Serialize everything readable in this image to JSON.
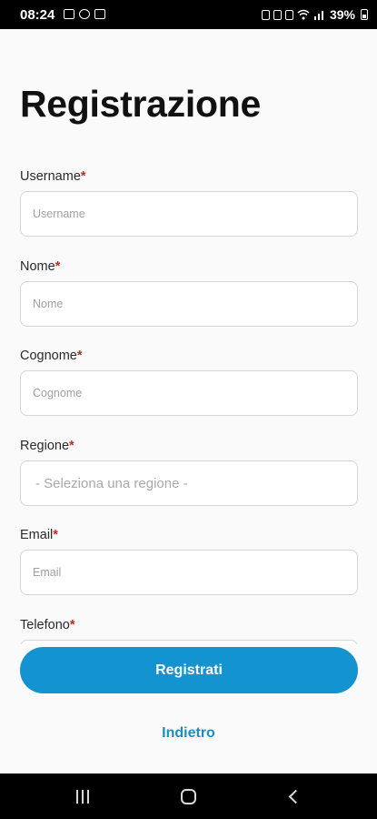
{
  "status_bar": {
    "time": "08:24",
    "battery_text": "39%",
    "left_icons": [
      "gallery-icon",
      "whatsapp-icon",
      "notification-icon"
    ],
    "right_icons": [
      "sim-icon",
      "alarm-icon",
      "mute-icon",
      "wifi-icon",
      "signal-icon",
      "battery-icon"
    ]
  },
  "page": {
    "title": "Registrazione"
  },
  "form": {
    "required_mark": "*",
    "fields": [
      {
        "label": "Username",
        "placeholder": "Username"
      },
      {
        "label": "Nome",
        "placeholder": "Nome"
      },
      {
        "label": "Cognome",
        "placeholder": "Cognome"
      },
      {
        "label": "Regione",
        "placeholder": "- Seleziona una regione -"
      },
      {
        "label": "Email",
        "placeholder": "Email"
      },
      {
        "label": "Telefono",
        "placeholder": ""
      }
    ]
  },
  "actions": {
    "register_label": "Registrati",
    "back_label": "Indietro"
  },
  "navigation_bar": {
    "icons": [
      "recents-icon",
      "home-icon",
      "back-icon"
    ]
  },
  "colors": {
    "accent": "#1493d1",
    "link": "#1a8fc5",
    "required": "#c62828",
    "background": "#fafafa"
  }
}
